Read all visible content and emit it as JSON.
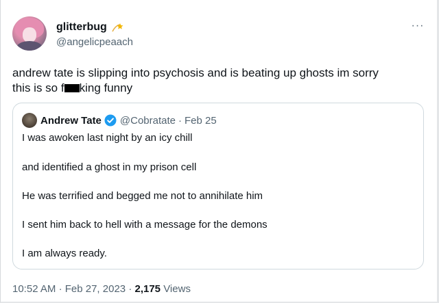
{
  "author": {
    "display_name": "glitterbug",
    "handle": "@angelicpeaach"
  },
  "more_label": "···",
  "tweet": {
    "text_line1": "andrew tate is slipping into psychosis and is beating up ghosts im sorry",
    "text_line2_before": "this is so f",
    "text_line2_after": "king funny"
  },
  "quote": {
    "name": "Andrew Tate",
    "handle": "@Cobratate",
    "separator": "·",
    "date": "Feb 25",
    "lines": [
      "I was awoken last night by an icy chill",
      "and identified a ghost in my prison cell",
      "He was terrified and begged me not to annihilate him",
      "I sent him back to hell with a message for the demons",
      "I am always ready."
    ]
  },
  "meta": {
    "time": "10:52 AM",
    "separator": "·",
    "date": "Feb 27, 2023",
    "views_count": "2,175",
    "views_label": "Views"
  },
  "colors": {
    "text": "#0f1419",
    "secondary": "#536471",
    "verified": "#1d9bf0",
    "border": "#cfd9de"
  },
  "icons": {
    "badge": "star-badge-icon",
    "verified": "verified-badge-icon",
    "more": "more-dots-icon"
  }
}
